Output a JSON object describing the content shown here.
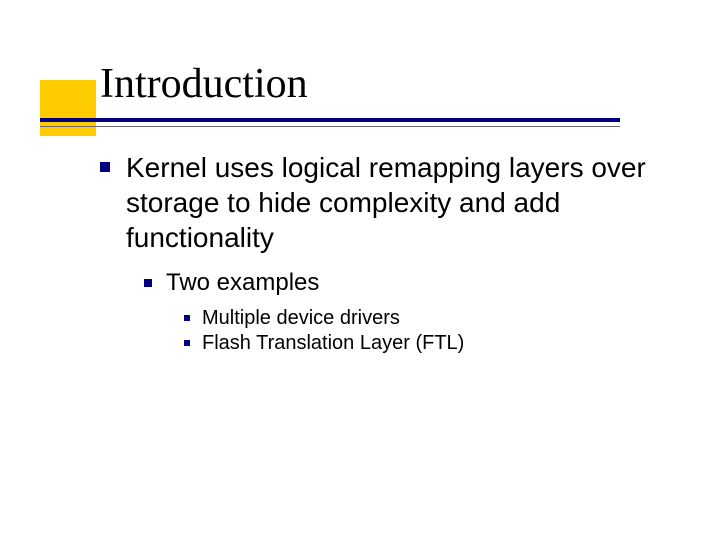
{
  "title": "Introduction",
  "bullets": {
    "lvl1": "Kernel uses logical remapping layers over storage to hide complexity and add functionality",
    "lvl2": "Two examples",
    "lvl3a": "Multiple device drivers",
    "lvl3b": "Flash Translation Layer (FTL)"
  }
}
